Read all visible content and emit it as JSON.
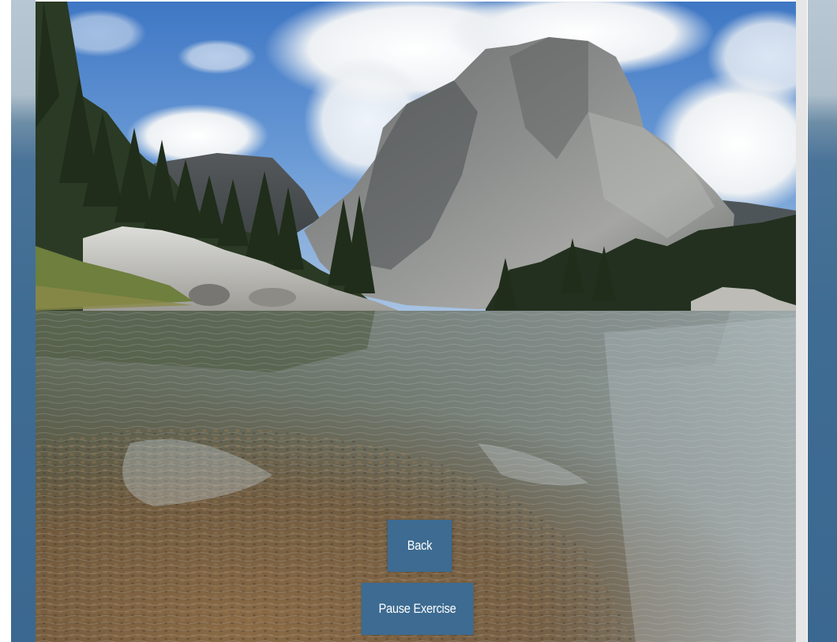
{
  "scene": {
    "image_label": "mountain-lake-landscape"
  },
  "controls": {
    "back_label": "Back",
    "pause_label": "Pause Exercise",
    "button_color": "#3d6b91",
    "side_strip_color": "#3f6c93"
  }
}
